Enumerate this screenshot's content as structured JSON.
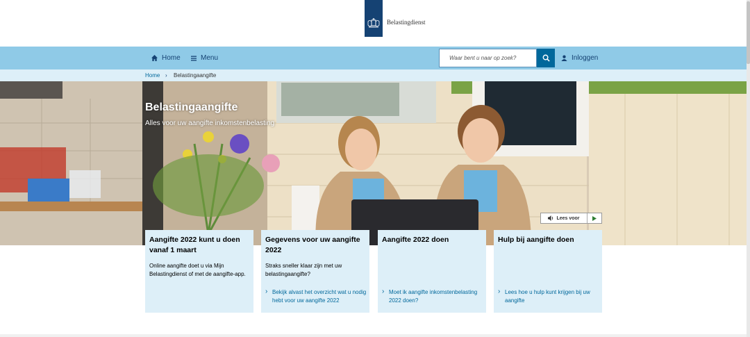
{
  "header": {
    "logo_text": "Belastingdienst"
  },
  "nav": {
    "home_label": "Home",
    "menu_label": "Menu",
    "search_placeholder": "Waar bent u naar op zoek?",
    "login_label": "Inloggen"
  },
  "breadcrumb": {
    "home": "Home",
    "current": "Belastingaangifte"
  },
  "hero": {
    "title": "Belastingaangifte",
    "subtitle": "Alles voor uw aangifte inkomstenbelasting",
    "read_aloud_label": "Lees voor"
  },
  "cards": [
    {
      "title": "Aangifte 2022 kunt u doen vanaf 1 maart",
      "text": "Online aangifte doet u via Mijn Belastingdienst of met de aangifte-app.",
      "link": ""
    },
    {
      "title": "Gegevens voor uw aangifte 2022",
      "text": "Straks sneller klaar zijn met uw belastingaangifte?",
      "link": "Bekijk alvast het overzicht wat u nodig hebt voor uw aangifte 2022"
    },
    {
      "title": "Aangifte 2022 doen",
      "text": "",
      "link": "Moet ik aangifte inkomstenbelasting 2022 doen?"
    },
    {
      "title": "Hulp bij aangifte doen",
      "text": "",
      "link": "Lees hoe u hulp kunt krijgen bij uw aangifte"
    }
  ],
  "colors": {
    "brand": "#154273",
    "nav_bg": "#8fcae7",
    "link": "#01689b",
    "card_bg": "#ddeff8"
  }
}
